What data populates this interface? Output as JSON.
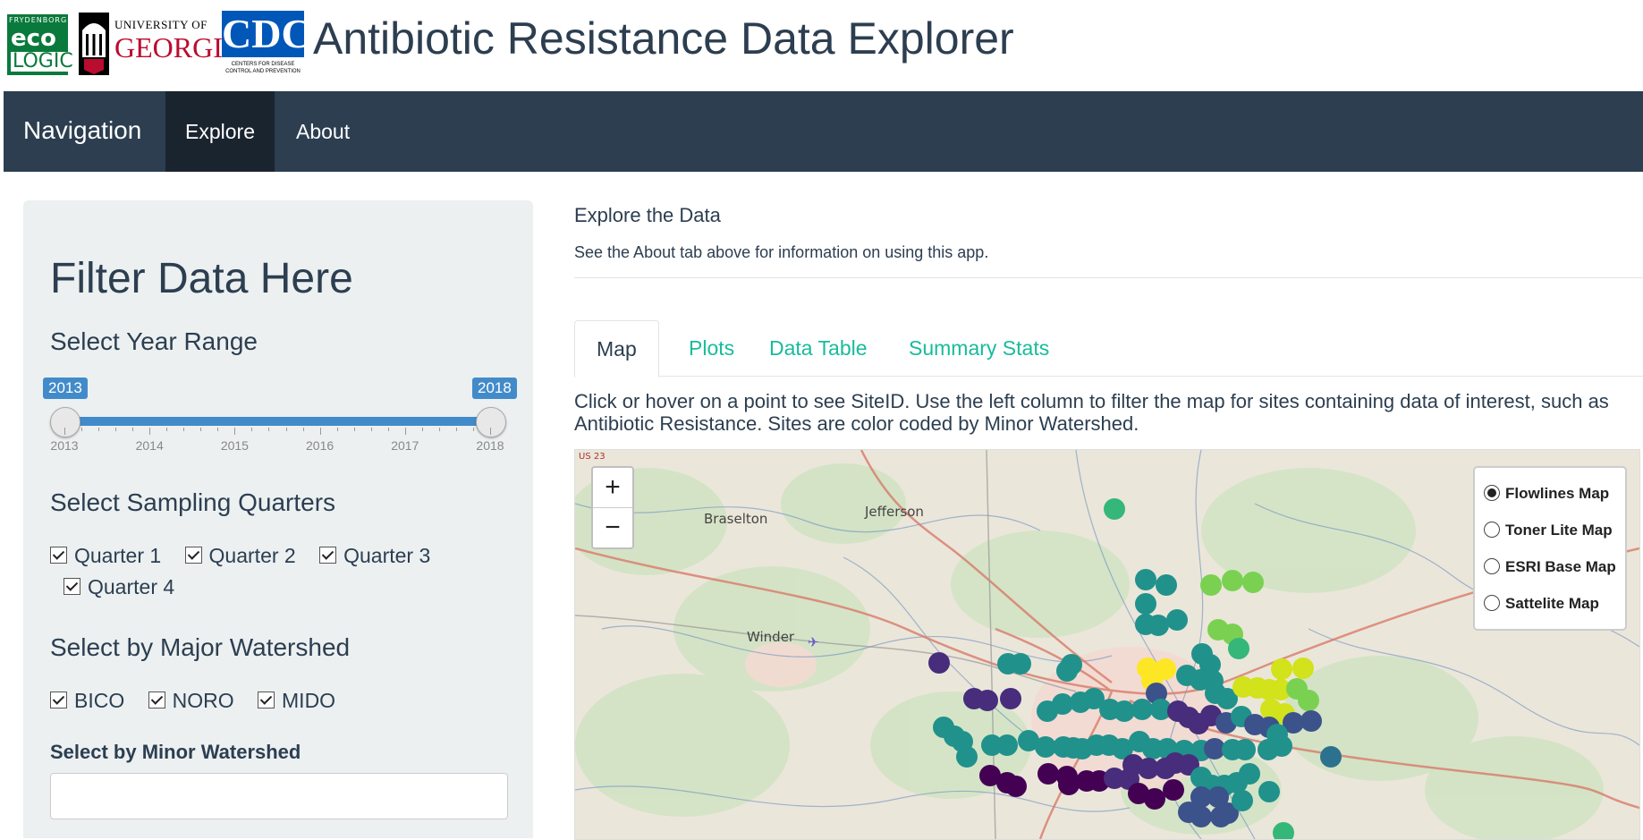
{
  "header": {
    "title": "Antibiotic Resistance Data Explorer",
    "logos": {
      "eco_top": "FRYDENBORG",
      "eco_mid": "eco",
      "eco_bot": "LOGIC",
      "uga_line1": "UNIVERSITY OF",
      "uga_line2": "GEORGIA",
      "cdc": "CDC",
      "cdc_sub": "CENTERS FOR DISEASE CONTROL AND PREVENTION"
    }
  },
  "navbar": {
    "brand": "Navigation",
    "tabs": [
      {
        "label": "Explore",
        "active": true
      },
      {
        "label": "About",
        "active": false
      }
    ],
    "bg_color": "#2c3e50"
  },
  "sidebar": {
    "title": "Filter Data Here",
    "year_range": {
      "heading": "Select Year Range",
      "min": 2013,
      "max": 2018,
      "selected_from": "2013",
      "selected_to": "2018",
      "ticks": [
        "2013",
        "2014",
        "2015",
        "2016",
        "2017",
        "2018"
      ]
    },
    "quarters": {
      "heading": "Select Sampling Quarters",
      "options": [
        "Quarter 1",
        "Quarter 2",
        "Quarter 3",
        "Quarter 4"
      ],
      "checked": [
        true,
        true,
        true,
        true
      ]
    },
    "major_watershed": {
      "heading": "Select by Major Watershed",
      "options": [
        "BICO",
        "NORO",
        "MIDO"
      ],
      "checked": [
        true,
        true,
        true
      ]
    },
    "minor_watershed": {
      "heading": "Select by Minor Watershed",
      "value": ""
    }
  },
  "main": {
    "heading": "Explore the Data",
    "subtext": "See the About tab above for information on using this app.",
    "tabs": [
      {
        "label": "Map",
        "active": true
      },
      {
        "label": "Plots",
        "active": false
      },
      {
        "label": "Data Table",
        "active": false
      },
      {
        "label": "Summary Stats",
        "active": false
      }
    ],
    "instructions": "Click or hover on a point to see SiteID. Use the left column to filter the map for sites containing data of interest, such as Antibiotic Resistance. Sites are color coded by Minor Watershed.",
    "accent_color": "#18bc9c"
  },
  "map": {
    "zoom_in": "+",
    "zoom_out": "−",
    "layers": [
      {
        "label": "Flowlines Map",
        "selected": true
      },
      {
        "label": "Toner Lite Map",
        "selected": false
      },
      {
        "label": "ESRI Base Map",
        "selected": false
      },
      {
        "label": "Sattelite Map",
        "selected": false
      }
    ],
    "towns": [
      "Braselton",
      "Jefferson",
      "Winder"
    ],
    "road_shield": "US 23"
  }
}
